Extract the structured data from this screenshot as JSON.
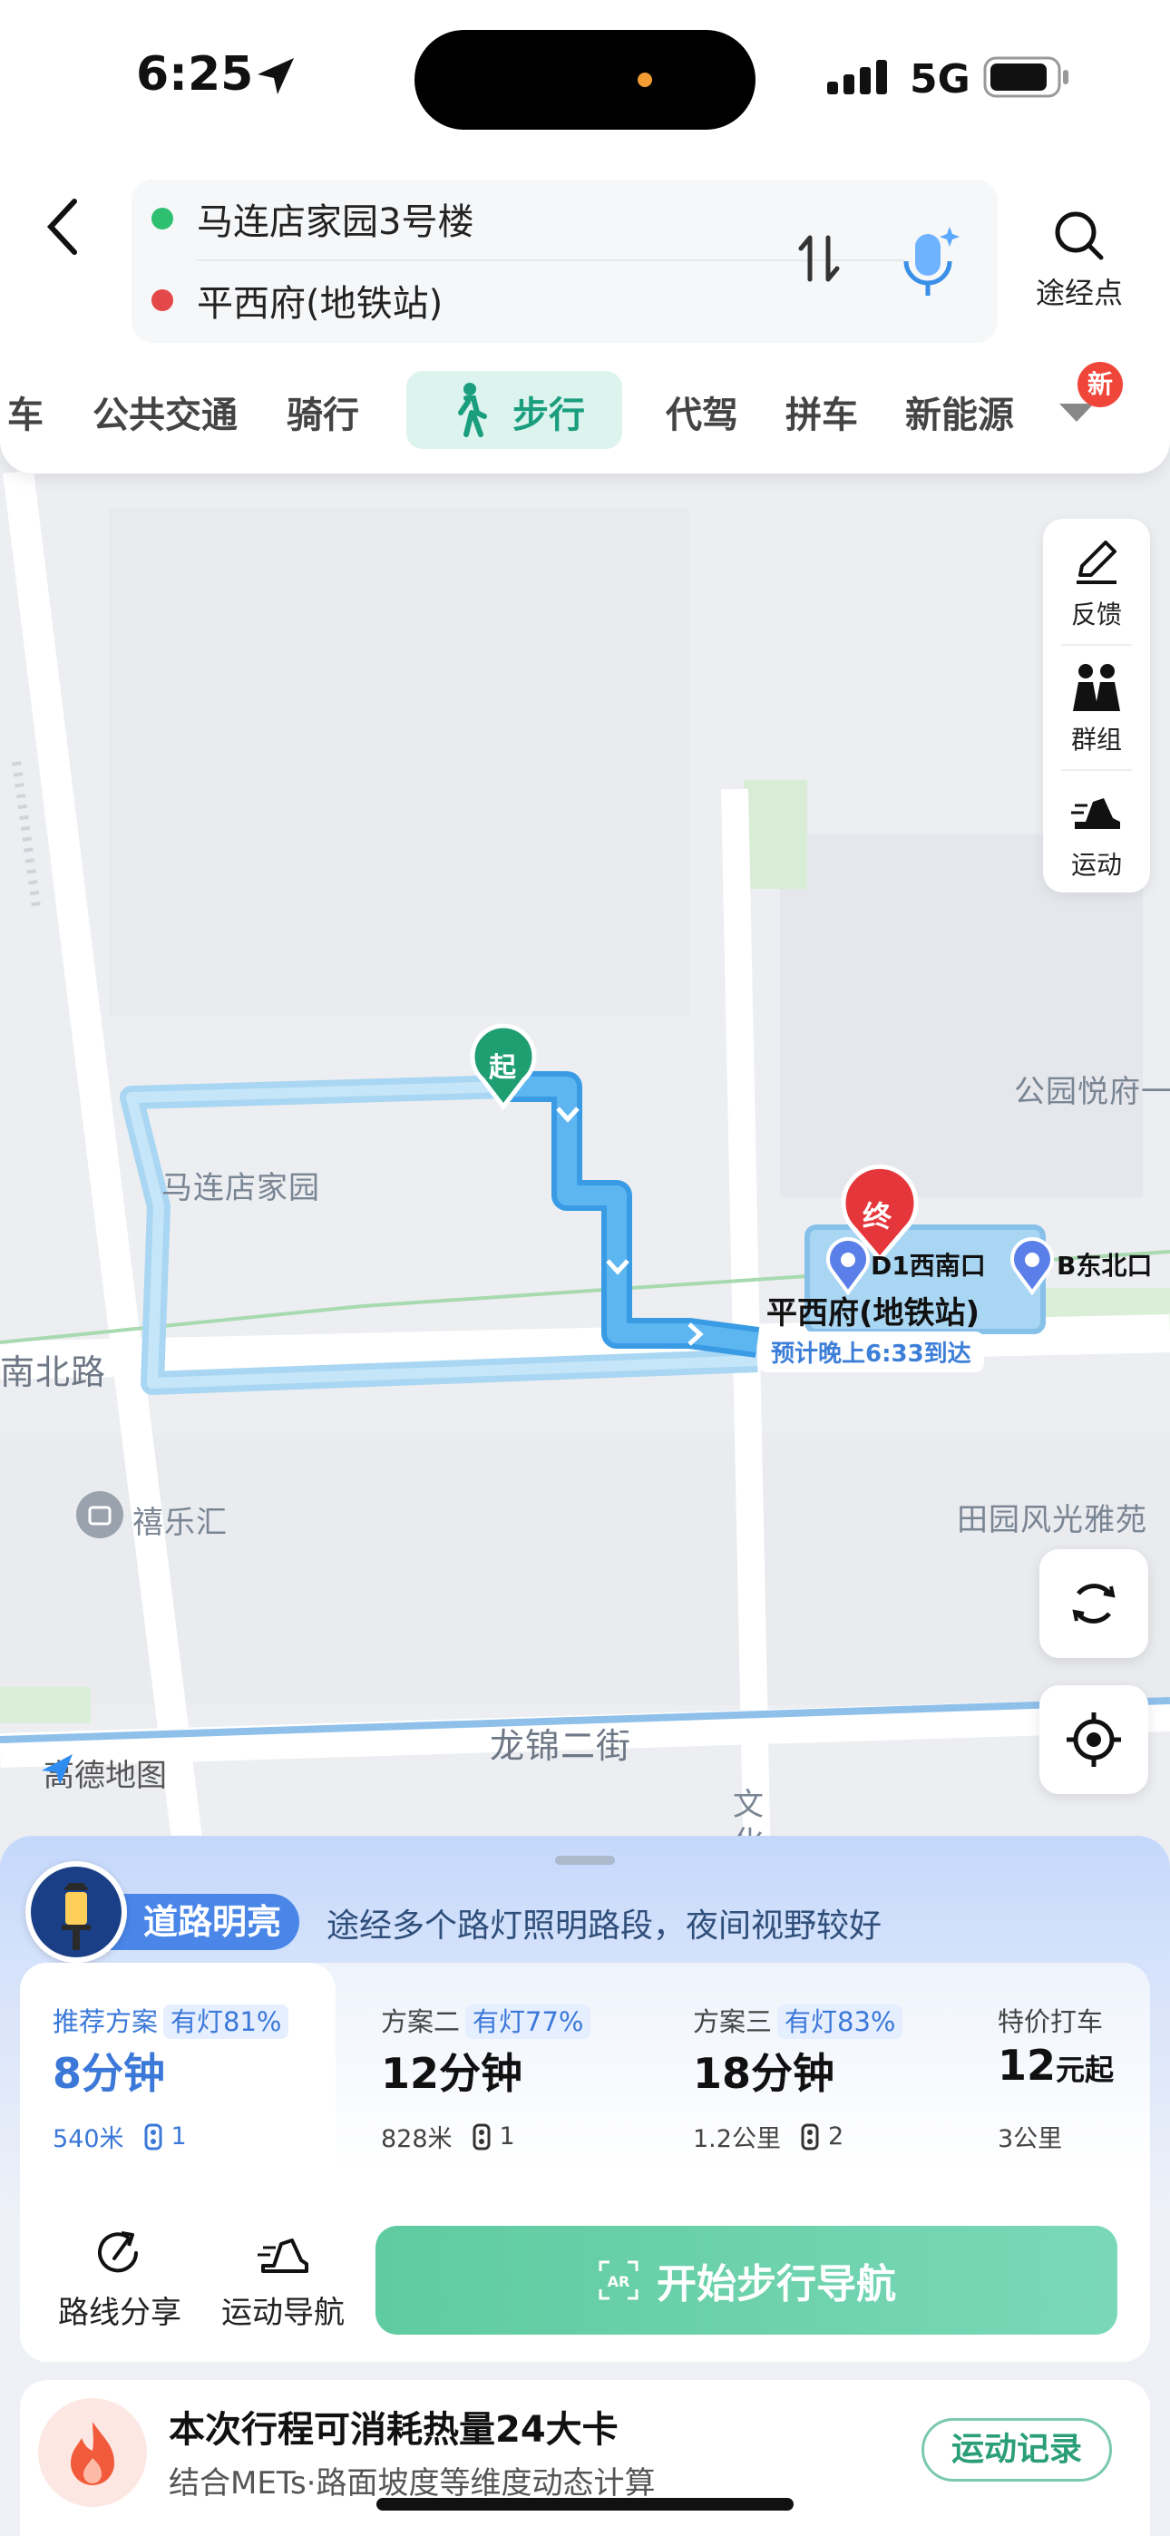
{
  "status": {
    "time": "6:25",
    "network": "5G"
  },
  "route": {
    "origin": "马连店家园3号楼",
    "destination": "平西府(地铁站)",
    "waypoint_label": "途经点",
    "origin_color": "#2fbf71",
    "destination_color": "#e54848"
  },
  "modes": {
    "items": [
      "车",
      "公共交通",
      "骑行",
      "步行",
      "代驾",
      "拼车",
      "新能源"
    ],
    "selected": "步行",
    "new_badge": "新"
  },
  "tools": {
    "feedback": "反馈",
    "group": "群组",
    "sport": "运动"
  },
  "map": {
    "labels": {
      "community": "马连店家园",
      "road_ns": "南北路",
      "mall": "禧乐汇",
      "park_estate": "公园悦府一",
      "garden": "田园风光雅苑",
      "street": "龙锦二街",
      "wen": "文",
      "hua": "化"
    },
    "start_marker": "起",
    "end_marker": "终",
    "station_name": "平西府(地铁站)",
    "exit_d1": "D1西南口",
    "exit_b": "B东北口",
    "eta": "预计晚上6:33到达",
    "logo_text": "高德地图",
    "route_color": "#4aa8ec",
    "alt_route_color": "#a9d6f2"
  },
  "highlight": {
    "badge": "道路明亮",
    "description": "途经多个路灯照明路段，夜间视野较好"
  },
  "plans": [
    {
      "name": "推荐方案",
      "tag": "有灯81%",
      "duration_num": "8",
      "duration_unit": "分钟",
      "distance": "540米",
      "crossings": "1"
    },
    {
      "name": "方案二",
      "tag": "有灯77%",
      "duration_num": "12",
      "duration_unit": "分钟",
      "distance": "828米",
      "crossings": "1"
    },
    {
      "name": "方案三",
      "tag": "有灯83%",
      "duration_num": "18",
      "duration_unit": "分钟",
      "distance": "1.2公里",
      "crossings": "2"
    },
    {
      "name": "特价打车",
      "price_num": "12",
      "price_unit": "元起",
      "distance": "3公里"
    }
  ],
  "actions": {
    "share": "路线分享",
    "sport_nav": "运动导航",
    "start": "开始步行导航"
  },
  "calories": {
    "title": "本次行程可消耗热量24大卡",
    "subtitle": "结合METs·路面坡度等维度动态计算",
    "record_button": "运动记录"
  }
}
